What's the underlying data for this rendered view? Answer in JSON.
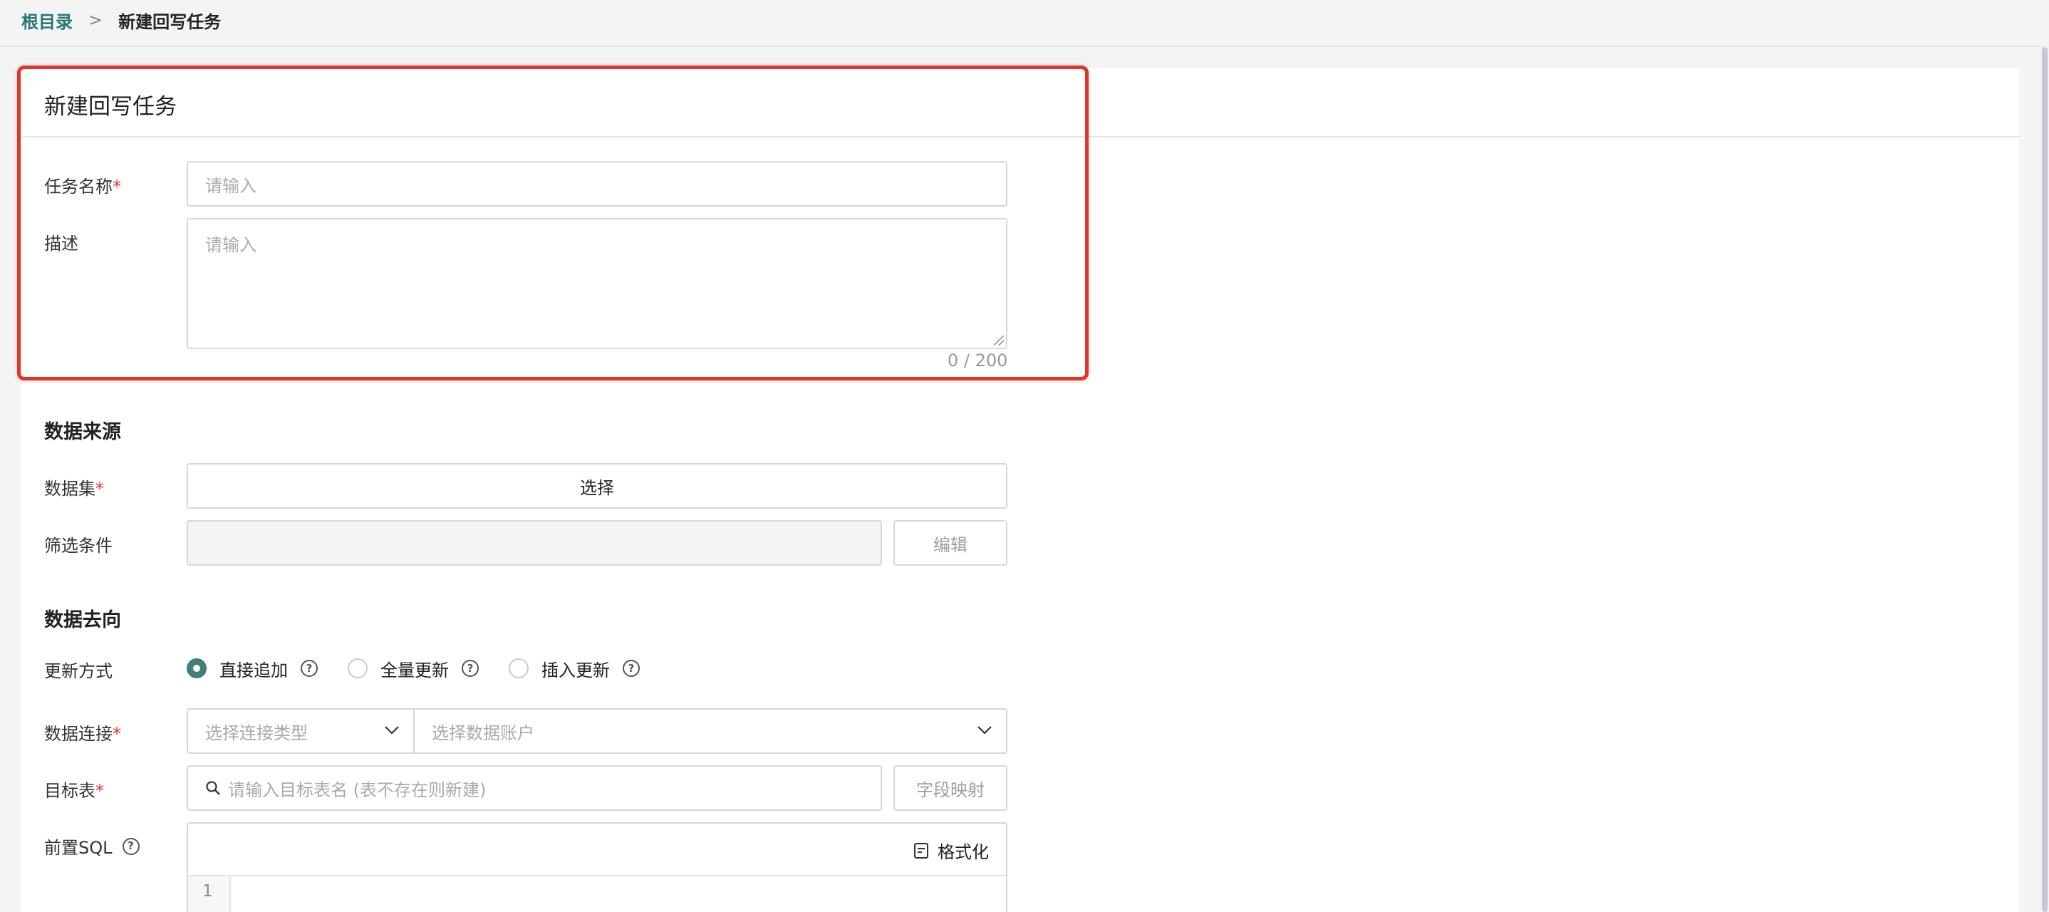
{
  "breadcrumb": {
    "root": "根目录",
    "separator": ">",
    "current": "新建回写任务"
  },
  "card": {
    "title": "新建回写任务"
  },
  "form": {
    "task_name": {
      "label": "任务名称",
      "required_mark": "*",
      "placeholder": "请输入"
    },
    "description": {
      "label": "描述",
      "placeholder": "请输入",
      "counter": "0 / 200"
    }
  },
  "data_source": {
    "title": "数据来源",
    "dataset": {
      "label": "数据集",
      "required_mark": "*",
      "button": "选择"
    },
    "filter": {
      "label": "筛选条件",
      "button": "编辑"
    }
  },
  "data_target": {
    "title": "数据去向",
    "update_mode": {
      "label": "更新方式",
      "options": [
        {
          "label": "直接追加",
          "checked": true
        },
        {
          "label": "全量更新",
          "checked": false
        },
        {
          "label": "插入更新",
          "checked": false
        }
      ]
    },
    "connection": {
      "label": "数据连接",
      "required_mark": "*",
      "type_placeholder": "选择连接类型",
      "account_placeholder": "选择数据账户"
    },
    "target_table": {
      "label": "目标表",
      "required_mark": "*",
      "placeholder": "请输入目标表名 (表不存在则新建)",
      "button": "字段映射"
    },
    "pre_sql": {
      "label": "前置SQL",
      "format_button": "格式化",
      "line_number": "1"
    }
  },
  "colors": {
    "accent": "#3e7f7a",
    "required": "#e0352b",
    "highlight": "#e0352b"
  }
}
